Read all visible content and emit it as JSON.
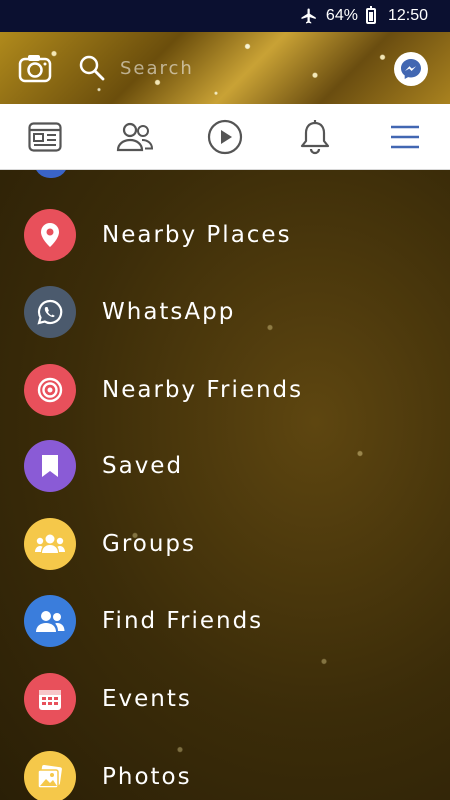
{
  "status_bar": {
    "battery": "64%",
    "time": "12:50"
  },
  "header": {
    "search_placeholder": "Search"
  },
  "tabs": [
    {
      "name": "news-feed"
    },
    {
      "name": "friends"
    },
    {
      "name": "watch"
    },
    {
      "name": "notifications"
    },
    {
      "name": "menu"
    }
  ],
  "menu": {
    "items": [
      {
        "label": "Nearby Places",
        "color": "#e8505b",
        "icon": "location-pin-icon"
      },
      {
        "label": "WhatsApp",
        "color": "#4b5a6d",
        "icon": "whatsapp-icon"
      },
      {
        "label": "Nearby Friends",
        "color": "#e8505b",
        "icon": "target-icon"
      },
      {
        "label": "Saved",
        "color": "#8a5bd6",
        "icon": "bookmark-icon"
      },
      {
        "label": "Groups",
        "color": "#f5c84a",
        "icon": "groups-icon"
      },
      {
        "label": "Find Friends",
        "color": "#3a7ddc",
        "icon": "find-friends-icon"
      },
      {
        "label": "Events",
        "color": "#e8505b",
        "icon": "calendar-icon"
      },
      {
        "label": "Photos",
        "color": "#f5c84a",
        "icon": "photos-icon"
      }
    ]
  },
  "colors": {
    "brand_blue": "#4267b2",
    "status_bar": "#0b1030"
  }
}
